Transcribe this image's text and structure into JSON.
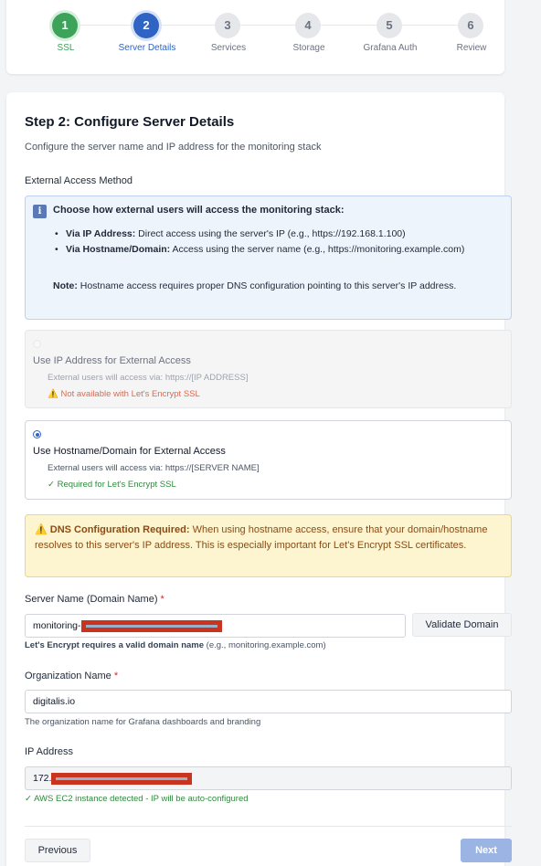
{
  "stepper": {
    "steps": [
      {
        "number": "1",
        "label": "SSL",
        "state": "done"
      },
      {
        "number": "2",
        "label": "Server Details",
        "state": "active"
      },
      {
        "number": "3",
        "label": "Services",
        "state": "pending"
      },
      {
        "number": "4",
        "label": "Storage",
        "state": "pending"
      },
      {
        "number": "5",
        "label": "Grafana Auth",
        "state": "pending"
      },
      {
        "number": "6",
        "label": "Review",
        "state": "pending"
      }
    ]
  },
  "page": {
    "title": "Step 2: Configure Server Details",
    "subtitle": "Configure the server name and IP address for the monitoring stack"
  },
  "access": {
    "section_label": "External Access Method",
    "info": {
      "heading": "Choose how external users will access the monitoring stack:",
      "items": [
        {
          "bold": "Via IP Address:",
          "text": " Direct access using the server's IP (e.g., https://192.168.1.100)"
        },
        {
          "bold": "Via Hostname/Domain:",
          "text": " Access using the server name (e.g., https://monitoring.example.com)"
        }
      ],
      "note_bold": "Note:",
      "note_text": " Hostname access requires proper DNS configuration pointing to this server's IP address."
    },
    "options": [
      {
        "title": "Use IP Address for External Access",
        "detail": "External users will access via: https://[IP ADDRESS]",
        "status": "⚠️ Not available with Let's Encrypt SSL",
        "selected": false,
        "disabled": true
      },
      {
        "title": "Use Hostname/Domain for External Access",
        "detail": "External users will access via: https://[SERVER NAME]",
        "status": "✓ Required for Let's Encrypt SSL",
        "selected": true,
        "disabled": false
      }
    ]
  },
  "dns_warning": {
    "bold": "⚠️ DNS Configuration Required:",
    "text": " When using hostname access, ensure that your domain/hostname resolves to this server's IP address. This is especially important for Let's Encrypt SSL certificates."
  },
  "server_name": {
    "label": "Server Name (Domain Name)",
    "required_mark": "*",
    "value_prefix": "monitoring-",
    "validate_button": "Validate Domain",
    "help_bold": "Let's Encrypt requires a valid domain name",
    "help_text": " (e.g., monitoring.example.com)"
  },
  "org_name": {
    "label": "Organization Name",
    "required_mark": "*",
    "value": "digitalis.io",
    "help": "The organization name for Grafana dashboards and branding"
  },
  "ip_address": {
    "label": "IP Address",
    "value_prefix": "172.",
    "help": "✓ AWS EC2 instance detected - IP will be auto-configured"
  },
  "footer": {
    "previous_label": "Previous",
    "next_label": "Next"
  },
  "colors": {
    "done": "#3ea35a",
    "active": "#2f63c4",
    "success_text": "#2f8a3c",
    "error_text": "#dc6a4e"
  }
}
